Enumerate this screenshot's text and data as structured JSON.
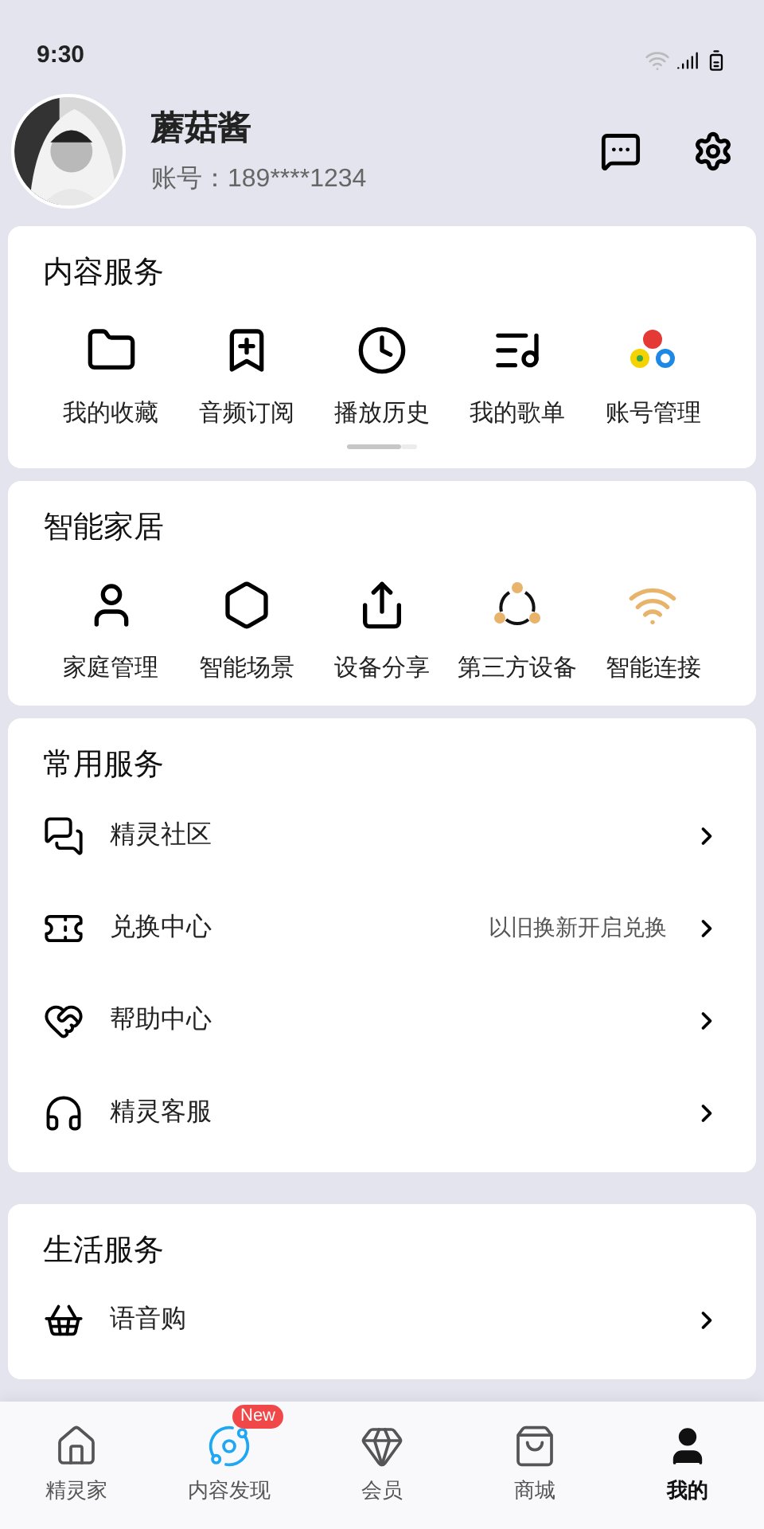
{
  "status_bar": {
    "time": "9:30"
  },
  "profile": {
    "name": "蘑菇酱",
    "account": "账号：189****1234"
  },
  "content_services": {
    "title": "内容服务",
    "items": [
      {
        "label": "我的收藏"
      },
      {
        "label": "音频订阅"
      },
      {
        "label": "播放历史"
      },
      {
        "label": "我的歌单"
      },
      {
        "label": "账号管理"
      }
    ]
  },
  "smart_home": {
    "title": "智能家居",
    "items": [
      {
        "label": "家庭管理"
      },
      {
        "label": "智能场景"
      },
      {
        "label": "设备分享"
      },
      {
        "label": "第三方设备"
      },
      {
        "label": "智能连接"
      }
    ]
  },
  "common_services": {
    "title": "常用服务",
    "rows": [
      {
        "label": "精灵社区"
      },
      {
        "label": "兑换中心",
        "note": "以旧换新开启兑换"
      },
      {
        "label": "帮助中心"
      },
      {
        "label": "精灵客服"
      }
    ]
  },
  "life_services": {
    "title": "生活服务",
    "rows": [
      {
        "label": "语音购"
      }
    ]
  },
  "nav": [
    {
      "label": "精灵家",
      "selected": false
    },
    {
      "label": "内容发现",
      "selected": false,
      "badge": "New"
    },
    {
      "label": "会员",
      "selected": false
    },
    {
      "label": "商城",
      "selected": false
    },
    {
      "label": "我的",
      "selected": true
    }
  ]
}
